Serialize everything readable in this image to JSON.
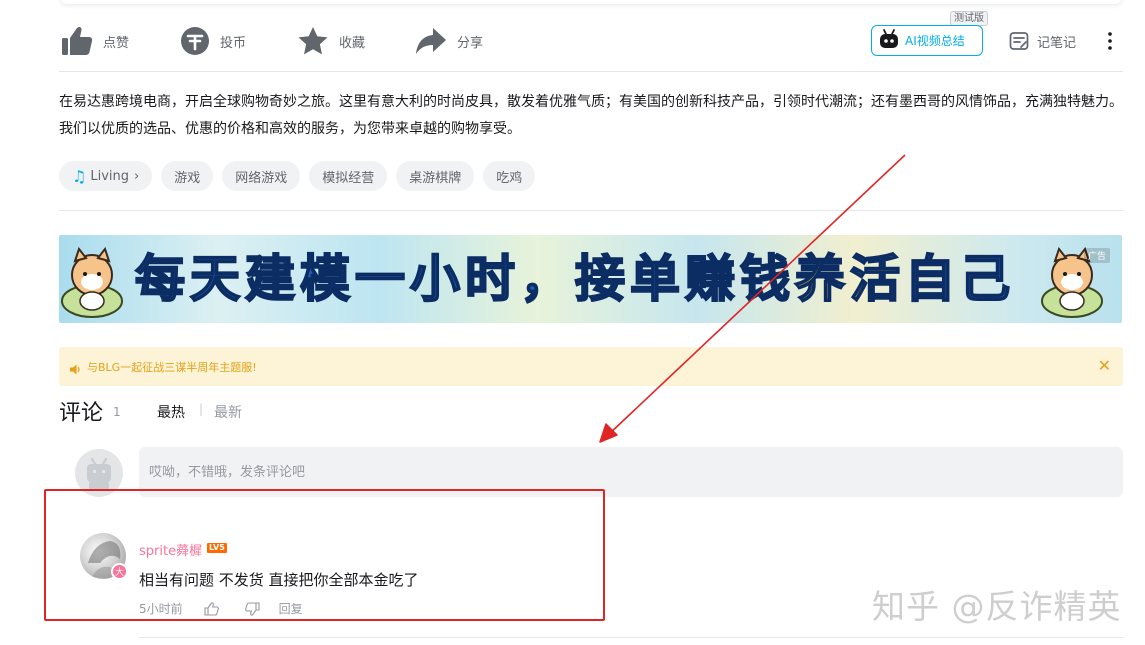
{
  "toolbar": {
    "like_label": "点赞",
    "coin_label": "投币",
    "favorite_label": "收藏",
    "share_label": "分享",
    "ai_summary_label": "AI视频总结",
    "beta_badge": "测试版",
    "notes_label": "记笔记"
  },
  "description": "在易达惠跨境电商，开启全球购物奇妙之旅。这里有意大利的时尚皮具，散发着优雅气质；有美国的创新科技产品，引领时代潮流；还有墨西哥的风情饰品，充满独特魅力。我们以优质的选品、优惠的价格和高效的服务，为您带来卓越的购物享受。",
  "tags": {
    "music_tag": "Living",
    "items": [
      "游戏",
      "网络游戏",
      "模拟经营",
      "桌游棋牌",
      "吃鸡"
    ]
  },
  "banner": {
    "text_main": "每天建模一小时，接单赚钱",
    "text_highlight": "养活",
    "text_tail": "自己",
    "ad_label": "广告"
  },
  "notice": {
    "text": "与BLG一起征战三谋半周年主题服!"
  },
  "comments": {
    "title": "评论",
    "count": "1",
    "sort_hot": "最热",
    "sort_sep": "|",
    "sort_new": "最新",
    "input_placeholder": "哎呦，不错哦，发条评论吧",
    "items": [
      {
        "username": "sprite蕣樨",
        "level": "LV5",
        "avatar_badge": "大",
        "text": "相当有问题 不发货 直接把你全部本金吃了",
        "time": "5小时前",
        "reply_label": "回复"
      }
    ]
  },
  "watermark": "知乎 @反诈精英",
  "colors": {
    "accent_blue": "#00aeec",
    "username_pink": "#fb7299",
    "notice_orange": "#e3a217",
    "annotation_red": "#e02525"
  }
}
